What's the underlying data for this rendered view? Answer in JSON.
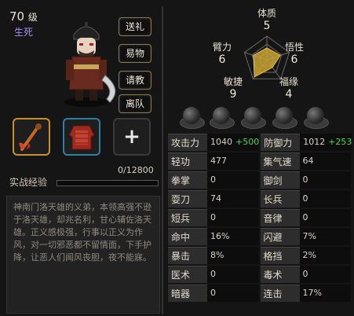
{
  "character": {
    "level_value": "70",
    "level_unit": "级",
    "faction": "生死"
  },
  "buttons": {
    "gift": "送礼",
    "trade": "易物",
    "consult": "请教",
    "leave": "离队"
  },
  "equipment": [
    {
      "name": "weapon-slot",
      "icon": "pipe-weapon-icon"
    },
    {
      "name": "armor-slot",
      "icon": "robe-armor-icon"
    },
    {
      "name": "add-slot",
      "icon": "plus-icon",
      "glyph": "+"
    }
  ],
  "experience": {
    "label": "实战经验",
    "current": 0,
    "max": 12800,
    "text": "0/12800"
  },
  "description": "神南门洛天雄的义弟，本领高强不逊于洛天雄，却兆名利，甘心辅佐洛天雄。正义感极强，行事以正义为作风，对一切邪恶都不留情面，下手护降，让恶人们闻风丧胆，夜不能寐。",
  "radar": {
    "attributes": [
      {
        "name": "体质",
        "value": "5"
      },
      {
        "name": "悟性",
        "value": "6"
      },
      {
        "name": "福缘",
        "value": "4"
      },
      {
        "name": "敏捷",
        "value": "9"
      },
      {
        "name": "臂力",
        "value": "6"
      }
    ],
    "max": 10,
    "fill_color": "#c8a232",
    "grid_color": "#6b6b6b"
  },
  "stats": [
    {
      "left": {
        "label": "攻击力",
        "value": "1040",
        "bonus": "+500"
      },
      "right": {
        "label": "防御力",
        "value": "1012",
        "bonus": "+253"
      }
    },
    {
      "left": {
        "label": "轻功",
        "value": "477"
      },
      "right": {
        "label": "集气速度",
        "value": "64"
      }
    },
    {
      "left": {
        "label": "拳掌",
        "value": "0"
      },
      "right": {
        "label": "御剑",
        "value": "0"
      }
    },
    {
      "left": {
        "label": "耍刀",
        "value": "74"
      },
      "right": {
        "label": "长兵",
        "value": "0"
      }
    },
    {
      "left": {
        "label": "短兵",
        "value": "0"
      },
      "right": {
        "label": "音律",
        "value": "0"
      }
    },
    {
      "left": {
        "label": "命中",
        "value": "16%"
      },
      "right": {
        "label": "闪避",
        "value": "7%"
      }
    },
    {
      "left": {
        "label": "暴击",
        "value": "8%"
      },
      "right": {
        "label": "格挡",
        "value": "2%"
      }
    },
    {
      "left": {
        "label": "医术",
        "value": "0"
      },
      "right": {
        "label": "毒术",
        "value": "0"
      }
    },
    {
      "left": {
        "label": "暗器",
        "value": "0"
      },
      "right": {
        "label": "连击",
        "value": "17%"
      }
    }
  ],
  "colors": {
    "bonus": "#4fd34f",
    "faction": "#a58cff",
    "slot_gold": "#c8912c",
    "slot_blue": "#2e7fa2"
  }
}
